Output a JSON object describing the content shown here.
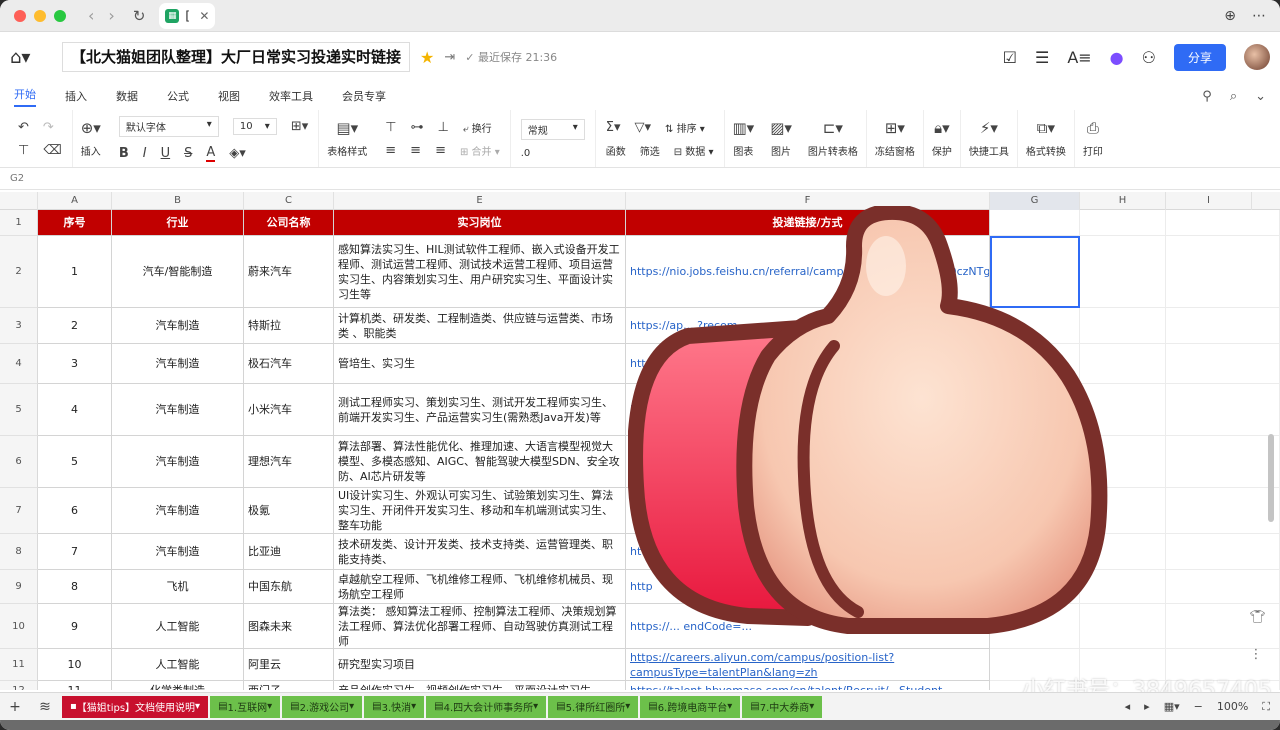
{
  "browser": {
    "tab_label": "["
  },
  "doc": {
    "title": "【北大猫姐团队整理】大厂日常实习投递实时链接",
    "saved_text": "最近保存 21:36",
    "share_label": "分享"
  },
  "menu": [
    "开始",
    "插入",
    "数据",
    "公式",
    "视图",
    "效率工具",
    "会员专享"
  ],
  "ribbon": {
    "insert": "插入",
    "font": "默认字体",
    "font_size": "10",
    "table_style": "表格样式",
    "wrap": "换行",
    "merge": "合并",
    "number_format": "常规",
    "decimals": ".0",
    "func": "函数",
    "filter": "筛选",
    "sort": "排序",
    "data": "数据",
    "chart": "图表",
    "image": "图片",
    "img_to_table": "图片转表格",
    "freeze": "冻结窗格",
    "protect": "保护",
    "quick_tools": "快捷工具",
    "format_convert": "格式转换",
    "print": "打印"
  },
  "cell_ref": "G2",
  "columns": [
    "A",
    "B",
    "C",
    "E",
    "F",
    "G",
    "H",
    "I"
  ],
  "headers": [
    "序号",
    "行业",
    "公司名称",
    "实习岗位",
    "投递链接/方式"
  ],
  "rows": [
    {
      "n": "2",
      "idx": "1",
      "ind": "汽车/智能制造",
      "co": "蔚来汽车",
      "pos": "感知算法实习生、HIL测试软件工程师、嵌入式设备开发工程师、测试运营工程师、测试技术运营工程师、项目运营实习生、内容策划实习生、用户研究实习生、平面设计实习生等",
      "link": "https://nio.jobs.feishu.cn/referral/campus/m...xNjg5ODIyNDczNTg0OzcwODc2NzU5OTIzNDk"
    },
    {
      "n": "3",
      "idx": "2",
      "ind": "汽车制造",
      "co": "特斯拉",
      "pos": "计算机类、研发类、工程制造类、供应链与运营类、市场类 、职能类",
      "link": "https://ap... ?recom..."
    },
    {
      "n": "4",
      "idx": "3",
      "ind": "汽车制造",
      "co": "极石汽车",
      "pos": "管培生、实习生",
      "link": "http"
    },
    {
      "n": "5",
      "idx": "4",
      "ind": "汽车制造",
      "co": "小米汽车",
      "pos": "测试工程师实习、策划实习生、测试开发工程师实习生、前端开发实习生、产品运营实习生(需熟悉Java开发)等",
      "link": "N"
    },
    {
      "n": "6",
      "idx": "5",
      "ind": "汽车制造",
      "co": "理想汽车",
      "pos": "算法部署、算法性能优化、推理加速、大语言模型视觉大模型、多模态感知、AIGC、智能驾驶大模型SDN、安全攻防、AI芯片研发等",
      "link": ""
    },
    {
      "n": "7",
      "idx": "6",
      "ind": "汽车制造",
      "co": "极氪",
      "pos": "UI设计实习生、外观认可实习生、试验策划实习生、算法实习生、开闭件开发实习生、移动和车机端测试实习生、整车功能",
      "link": ""
    },
    {
      "n": "8",
      "idx": "7",
      "ind": "汽车制造",
      "co": "比亚迪",
      "pos": "技术研发类、设计开发类、技术支持类、运营管理类、职能支持类、",
      "link": "ht"
    },
    {
      "n": "9",
      "idx": "8",
      "ind": "飞机",
      "co": "中国东航",
      "pos": "卓越航空工程师、飞机维修工程师、飞机维修机械员、现场航空工程师",
      "link": "http"
    },
    {
      "n": "10",
      "idx": "9",
      "ind": "人工智能",
      "co": "图森未来",
      "pos": "算法类： 感知算法工程师、控制算法工程师、决策规划算法工程师、算法优化部署工程师、自动驾驶仿真测试工程师",
      "link": "https://... endCode=..."
    },
    {
      "n": "11",
      "idx": "10",
      "ind": "人工智能",
      "co": "阿里云",
      "pos": "研究型实习项目",
      "link": "https://careers.aliyun.com/campus/position-list?campusType=talentPlan&lang=zh"
    }
  ],
  "partial_row": {
    "n": "12",
    "idx": "11",
    "ind": "化学类制造",
    "co": "西门子",
    "pos": "产品创作实习生、视频创作实习生、平面设计实习生",
    "link": "https://talent.hbvomaso.com/en/talent/Recruit/...Student"
  },
  "sheets": [
    {
      "label": "【猫姐tips】文档使用说明",
      "kind": "red"
    },
    {
      "label": "1.互联网",
      "kind": "green"
    },
    {
      "label": "2.游戏公司",
      "kind": "green"
    },
    {
      "label": "3.快消",
      "kind": "green"
    },
    {
      "label": "4.四大会计师事务所",
      "kind": "green"
    },
    {
      "label": "5.律所红圈所",
      "kind": "green"
    },
    {
      "label": "6.跨境电商平台",
      "kind": "green"
    },
    {
      "label": "7.中大券商",
      "kind": "green"
    }
  ],
  "zoom": "100%",
  "watermark": "小红书号：3849657405"
}
